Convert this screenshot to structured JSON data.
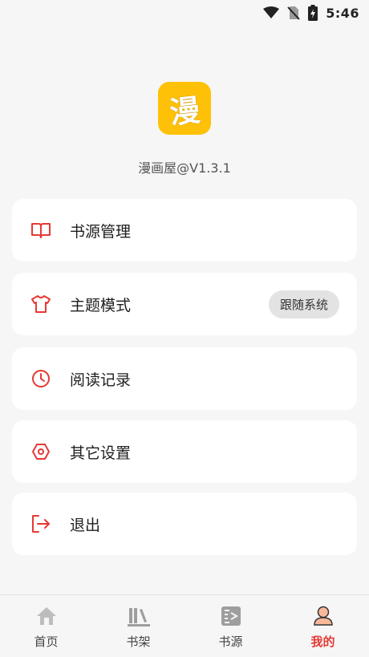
{
  "status_bar": {
    "time": "5:46",
    "icons": [
      "wifi-icon",
      "no-sim-icon",
      "battery-charging-icon"
    ]
  },
  "app": {
    "logo_char": "漫",
    "version_text": "漫画屋@V1.3.1",
    "logo_color": "#ffc107"
  },
  "menu": {
    "items": [
      {
        "label": "书源管理",
        "icon": "book-open-icon"
      },
      {
        "label": "主题模式",
        "icon": "tshirt-icon",
        "badge": "跟随系统"
      },
      {
        "label": "阅读记录",
        "icon": "clock-icon"
      },
      {
        "label": "其它设置",
        "icon": "settings-hexagon-icon"
      },
      {
        "label": "退出",
        "icon": "logout-icon"
      }
    ]
  },
  "bottom_nav": {
    "items": [
      {
        "label": "首页",
        "icon": "home-icon"
      },
      {
        "label": "书架",
        "icon": "bookshelf-icon"
      },
      {
        "label": "书源",
        "icon": "source-icon"
      },
      {
        "label": "我的",
        "icon": "profile-icon",
        "active": true
      }
    ]
  },
  "colors": {
    "accent": "#e53935",
    "background": "#f6f6f6",
    "card": "#ffffff"
  }
}
